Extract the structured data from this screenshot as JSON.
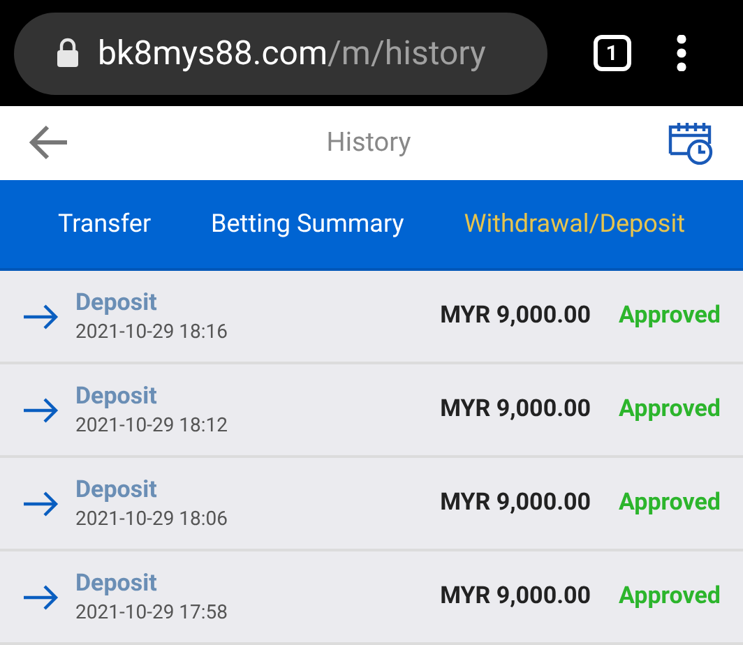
{
  "browser": {
    "url_host": "bk8mys88.com",
    "url_path": "/m/history",
    "tab_count": "1"
  },
  "header": {
    "title": "History"
  },
  "tabs": [
    {
      "label": "Transfer",
      "selected": false
    },
    {
      "label": "Betting Summary",
      "selected": false
    },
    {
      "label": "Withdrawal/Deposit",
      "selected": true
    }
  ],
  "rows": [
    {
      "type": "Deposit",
      "time": "2021-10-29 18:16",
      "amount": "MYR 9,000.00",
      "status": "Approved"
    },
    {
      "type": "Deposit",
      "time": "2021-10-29 18:12",
      "amount": "MYR 9,000.00",
      "status": "Approved"
    },
    {
      "type": "Deposit",
      "time": "2021-10-29 18:06",
      "amount": "MYR 9,000.00",
      "status": "Approved"
    },
    {
      "type": "Deposit",
      "time": "2021-10-29 17:58",
      "amount": "MYR 9,000.00",
      "status": "Approved"
    }
  ]
}
